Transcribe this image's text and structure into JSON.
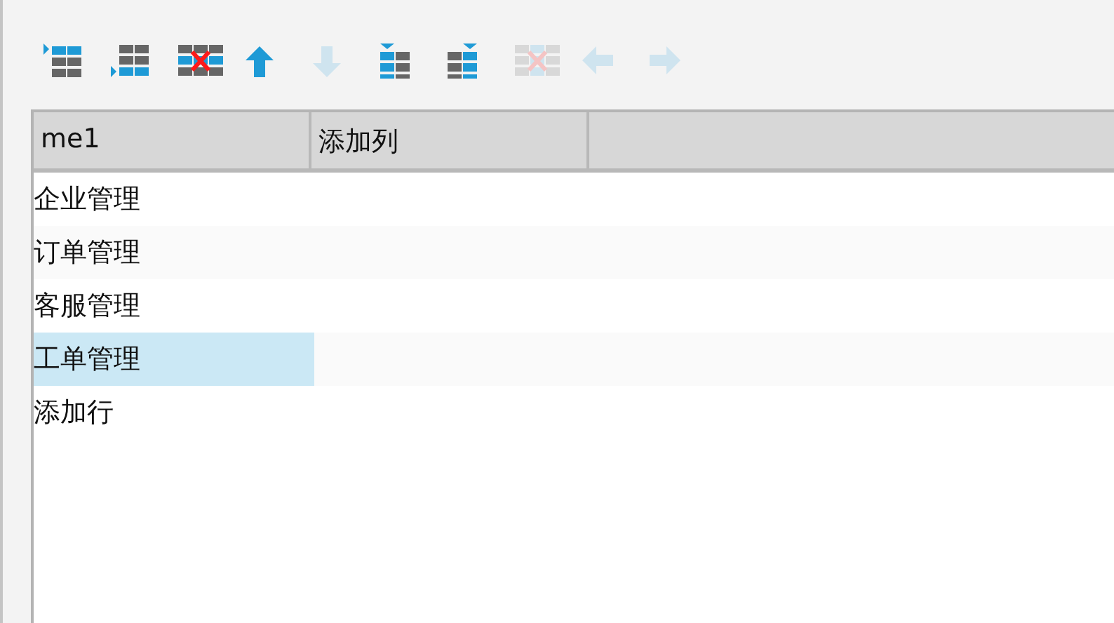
{
  "toolbar": [
    {
      "kind": "insert-row-above",
      "disabled": false
    },
    {
      "kind": "insert-row-below",
      "disabled": false
    },
    {
      "kind": "delete-row",
      "disabled": false
    },
    {
      "kind": "move-up",
      "disabled": false
    },
    {
      "kind": "move-down",
      "disabled": true
    },
    {
      "kind": "insert-col-left",
      "disabled": false
    },
    {
      "kind": "insert-col-right",
      "disabled": false
    },
    {
      "kind": "delete-col",
      "disabled": true
    },
    {
      "kind": "move-left",
      "disabled": true
    },
    {
      "kind": "move-right",
      "disabled": true
    }
  ],
  "table": {
    "columns": [
      "me1",
      "添加列"
    ],
    "rows": [
      {
        "cells": [
          {
            "text": "企业管理",
            "selected": false
          }
        ]
      },
      {
        "cells": [
          {
            "text": "订单管理",
            "selected": false
          }
        ]
      },
      {
        "cells": [
          {
            "text": "客服管理",
            "selected": false
          }
        ]
      },
      {
        "cells": [
          {
            "text": "工单管理",
            "selected": true
          }
        ]
      },
      {
        "cells": [
          {
            "text": "添加行",
            "selected": false
          }
        ]
      }
    ]
  }
}
